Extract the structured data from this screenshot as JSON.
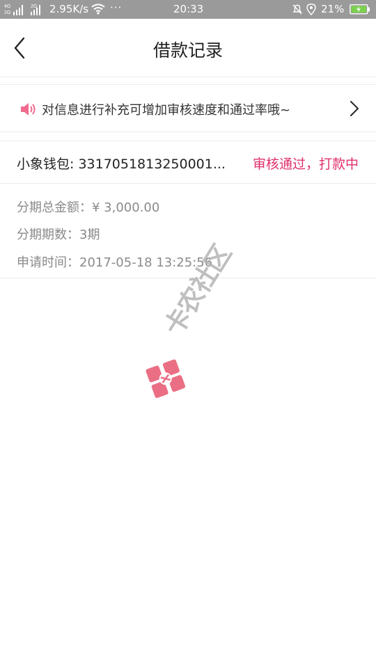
{
  "status_bar": {
    "speed": "2.95K/s",
    "dots": "···",
    "time": "20:33",
    "battery": "21%",
    "sig_labels": [
      "4G",
      "2G",
      "2G"
    ]
  },
  "nav": {
    "title": "借款记录",
    "back_icon": "chevron-left-icon"
  },
  "notice": {
    "text": "对信息进行补充可增加审核速度和通过率哦~",
    "speaker_icon": "speaker-icon",
    "arrow_icon": "chevron-right-icon",
    "accent": "#e0306b"
  },
  "record": {
    "loan_id": "小象钱包: 3317051813250001...",
    "status": "审核通过，打款中",
    "status_color": "#e0306b",
    "amount": "分期总金额：¥ 3,000.00",
    "periods": "分期期数：3期",
    "apply_time": "申请时间：2017-05-18 13:25:56"
  },
  "watermark": {
    "text": "卡农社区"
  }
}
